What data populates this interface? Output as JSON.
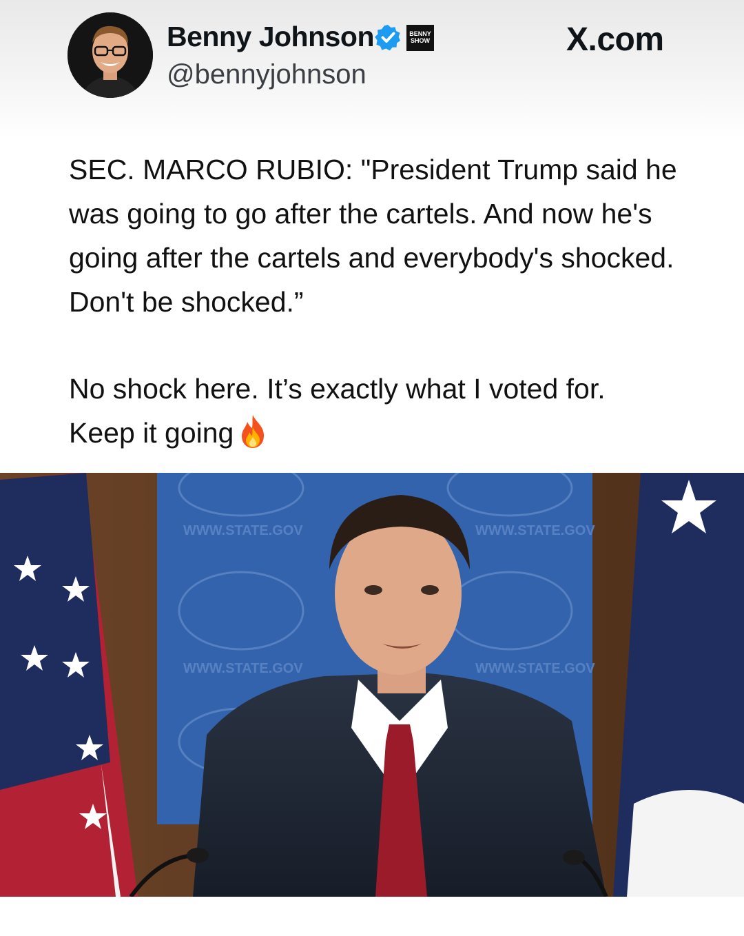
{
  "header": {
    "display_name": "Benny Johnson",
    "handle": "@bennyjohnson",
    "site": "X.com",
    "show_logo_text": "BENNY SHOW",
    "verified_color": "#1d9bf0"
  },
  "tweet": {
    "paragraph_1": "SEC. MARCO RUBIO: \"President Trump said he was going to go after the cartels. And now he's going after the cartels and everybody's shocked. Don't be shocked.”",
    "paragraph_2": "No shock here. It’s exactly what I voted for.",
    "paragraph_3": "Keep it going",
    "emoji": "fire-icon"
  },
  "media": {
    "backdrop_text": "WWW.STATE.GOV",
    "backdrop_color": "#2f5fa8"
  }
}
